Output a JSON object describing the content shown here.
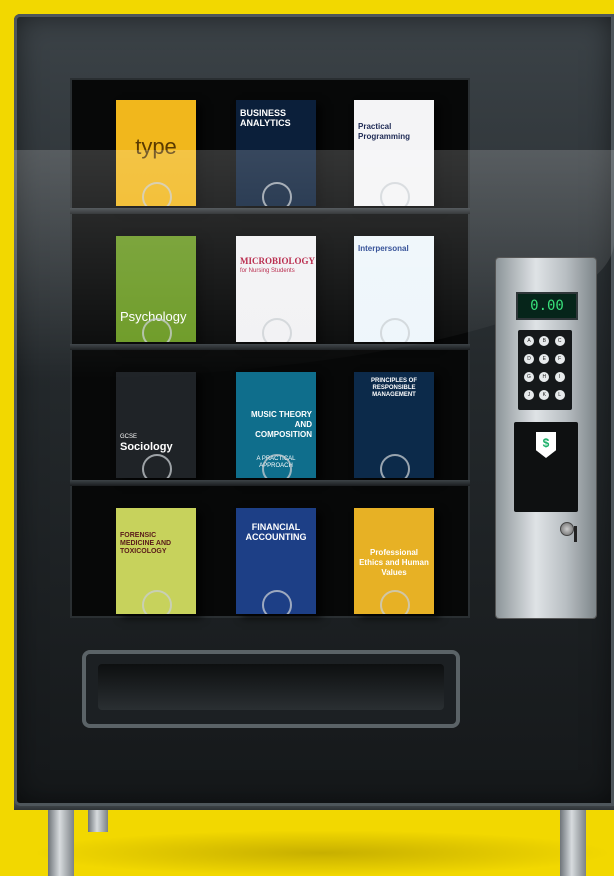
{
  "display": {
    "price": "0.00"
  },
  "keypad": {
    "keys": [
      "A",
      "B",
      "C",
      "D",
      "E",
      "F",
      "G",
      "H",
      "I",
      "J",
      "K",
      "L"
    ]
  },
  "bill_acceptor": {
    "symbol": "$"
  },
  "colors": {
    "background": "#f2d800",
    "display_text": "#38e07a",
    "machine_body": "#24292c"
  },
  "shelves": [
    {
      "books": [
        {
          "title": "type",
          "subtitle": "",
          "bg": "#f1b71c",
          "fg": "#5a3a00"
        },
        {
          "title": "BUSINESS ANALYTICS",
          "subtitle": "",
          "bg": "#0b1f3a",
          "fg": "#ffffff"
        },
        {
          "title": "Practical Programming",
          "subtitle": "",
          "bg": "#f4f4f6",
          "fg": "#1e2a55"
        }
      ]
    },
    {
      "books": [
        {
          "title": "Psychology",
          "subtitle": "",
          "bg": "#6c9a25",
          "fg": "#ffffff"
        },
        {
          "title": "MICROBIOLOGY",
          "subtitle": "for Nursing Students",
          "bg": "#f2f2f4",
          "fg": "#b3183d"
        },
        {
          "title": "Interpersonal",
          "subtitle": "",
          "bg": "#eef6fb",
          "fg": "#1f3e8c"
        }
      ]
    },
    {
      "books": [
        {
          "title": "Sociology",
          "subtitle": "GCSE",
          "bg": "#1f2327",
          "fg": "#ffffff"
        },
        {
          "title": "MUSIC THEORY AND COMPOSITION",
          "subtitle": "A PRACTICAL APPROACH",
          "bg": "#0f6e8c",
          "fg": "#ffffff"
        },
        {
          "title": "PRINCIPLES OF RESPONSIBLE MANAGEMENT",
          "subtitle": "",
          "bg": "#0c2a4a",
          "fg": "#ffffff"
        }
      ]
    },
    {
      "books": [
        {
          "title": "FORENSIC MEDICINE AND TOXICOLOGY",
          "subtitle": "",
          "bg": "#c7d25c",
          "fg": "#5a1a1a"
        },
        {
          "title": "FINANCIAL ACCOUNTING",
          "subtitle": "",
          "bg": "#1d3f86",
          "fg": "#ffffff"
        },
        {
          "title": "Professional Ethics and Human Values",
          "subtitle": "",
          "bg": "#e7b125",
          "fg": "#ffffff"
        }
      ]
    }
  ]
}
